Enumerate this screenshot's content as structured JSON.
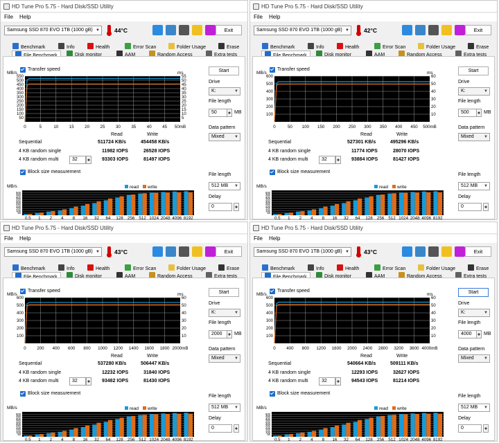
{
  "app": {
    "title": "HD Tune Pro 5.75 - Hard Disk/SSD Utility",
    "menu": {
      "file": "File",
      "help": "Help"
    },
    "drive": "Samsung SSD 870 EVO 1TB (1000 gB)",
    "exit_label": "Exit"
  },
  "tabs_top": [
    "Benchmark",
    "Info",
    "Health",
    "Error Scan",
    "Folder Usage",
    "Erase"
  ],
  "tabs_bottom": [
    "File Benchmark",
    "Disk monitor",
    "AAM",
    "Random Access",
    "Extra tests"
  ],
  "labels": {
    "transfer_speed": "Transfer speed",
    "block_size": "Block size measurement",
    "mbs": "MB/s",
    "ms": "ms",
    "read": "Read",
    "write": "Write",
    "sequential": "Sequential",
    "rnd_single": "4 KB random single",
    "rnd_multi": "4 KB random multi",
    "start": "Start",
    "drive": "Drive",
    "file_length": "File length",
    "data_pattern": "Data pattern",
    "delay": "Delay",
    "mb": "MB",
    "legend_read": "read",
    "legend_write": "write"
  },
  "colors": {
    "read": "#1b9ad6",
    "write": "#e06c18",
    "grid": "#9a9a9a",
    "chart_bg": "#000000"
  },
  "windows": [
    {
      "temp": "44°C",
      "drive_letter": "K:",
      "file_length": "50",
      "data_pattern": "Mixed",
      "multi_queue": "32",
      "block_file_length": "512 MB",
      "delay": "0",
      "results": {
        "seq_read": "511724 KB/s",
        "seq_write": "454458 KB/s",
        "single_read": "11982 IOPS",
        "single_write": "26528 IOPS",
        "multi_read": "93303 IOPS",
        "multi_write": "81497 IOPS"
      },
      "transfer_chart": {
        "x_ticks": [
          "0",
          "5",
          "10",
          "15",
          "20",
          "25",
          "30",
          "35",
          "40",
          "45",
          "50mB"
        ],
        "y_ticks": [
          "550",
          "500",
          "450",
          "400",
          "350",
          "300",
          "250",
          "200",
          "150",
          "100",
          "50"
        ],
        "ms_ticks": [
          "55",
          "50",
          "45",
          "40",
          "35",
          "30",
          "25",
          "20",
          "15",
          "10",
          "5"
        ],
        "ymax": 550,
        "msmax": 55,
        "xmax": 50,
        "read_level": 520,
        "write_level": 455
      }
    },
    {
      "temp": "42°C",
      "drive_letter": "K:",
      "file_length": "500",
      "data_pattern": "Mixed",
      "multi_queue": "32",
      "block_file_length": "512 MB",
      "delay": "0",
      "results": {
        "seq_read": "527301 KB/s",
        "seq_write": "495296 KB/s",
        "single_read": "11774 IOPS",
        "single_write": "28070 IOPS",
        "multi_read": "93884 IOPS",
        "multi_write": "81427 IOPS"
      },
      "transfer_chart": {
        "x_ticks": [
          "0",
          "50",
          "100",
          "150",
          "200",
          "250",
          "300",
          "350",
          "400",
          "450",
          "500mB"
        ],
        "y_ticks": [
          "600",
          "500",
          "400",
          "300",
          "200",
          "100"
        ],
        "ms_ticks": [
          "60",
          "50",
          "40",
          "30",
          "20",
          "10"
        ],
        "ymax": 600,
        "msmax": 60,
        "xmax": 500,
        "read_level": 527,
        "write_level": 495
      }
    },
    {
      "temp": "43°C",
      "drive_letter": "K:",
      "file_length": "2000",
      "data_pattern": "Mixed",
      "multi_queue": "32",
      "block_file_length": "512 MB",
      "delay": "0",
      "results": {
        "seq_read": "537280 KB/s",
        "seq_write": "506447 KB/s",
        "single_read": "12232 IOPS",
        "single_write": "31840 IOPS",
        "multi_read": "93482 IOPS",
        "multi_write": "81430 IOPS"
      },
      "transfer_chart": {
        "x_ticks": [
          "0",
          "200",
          "400",
          "600",
          "800",
          "1000",
          "1200",
          "1400",
          "1600",
          "1800",
          "2000mB"
        ],
        "y_ticks": [
          "600",
          "500",
          "400",
          "300",
          "200",
          "100"
        ],
        "ms_ticks": [
          "60",
          "50",
          "40",
          "30",
          "20",
          "10"
        ],
        "ymax": 600,
        "msmax": 60,
        "xmax": 2000,
        "read_level": 537,
        "write_level": 506
      }
    },
    {
      "temp": "43°C",
      "drive_letter": "K:",
      "file_length": "4000",
      "data_pattern": "Mixed",
      "multi_queue": "32",
      "block_file_length": "512 MB",
      "delay": "0",
      "results": {
        "seq_read": "540664 KB/s",
        "seq_write": "509111 KB/s",
        "single_read": "12293 IOPS",
        "single_write": "32627 IOPS",
        "multi_read": "94543 IOPS",
        "multi_write": "81214 IOPS"
      },
      "transfer_chart": {
        "x_ticks": [
          "0",
          "400",
          "800",
          "1200",
          "1600",
          "2000",
          "2400",
          "2800",
          "3200",
          "3600",
          "4000mB"
        ],
        "y_ticks": [
          "600",
          "500",
          "400",
          "300",
          "200",
          "100"
        ],
        "ms_ticks": [
          "60",
          "50",
          "40",
          "30",
          "20",
          "10"
        ],
        "ymax": 600,
        "msmax": 60,
        "xmax": 4000,
        "read_level": 541,
        "write_level": 509
      }
    }
  ],
  "chart_data": {
    "type": "bar",
    "xlabel": "",
    "ylabel": "MB/s",
    "categories": [
      "0.5",
      "1",
      "2",
      "4",
      "8",
      "16",
      "32",
      "64",
      "128",
      "256",
      "512",
      "1024",
      "2048",
      "4096",
      "8192"
    ],
    "y_ticks": [
      "500",
      "450",
      "400",
      "350",
      "300",
      "250",
      "200",
      "150",
      "100",
      "50"
    ],
    "ylim": [
      0,
      550
    ],
    "series": [
      {
        "name": "read",
        "values": [
          28,
          55,
          80,
          110,
          160,
          215,
          270,
          330,
          390,
          450,
          480,
          500,
          515,
          525,
          530
        ]
      },
      {
        "name": "write",
        "values": [
          30,
          60,
          90,
          130,
          190,
          250,
          310,
          370,
          420,
          460,
          485,
          495,
          505,
          510,
          510
        ]
      }
    ]
  }
}
